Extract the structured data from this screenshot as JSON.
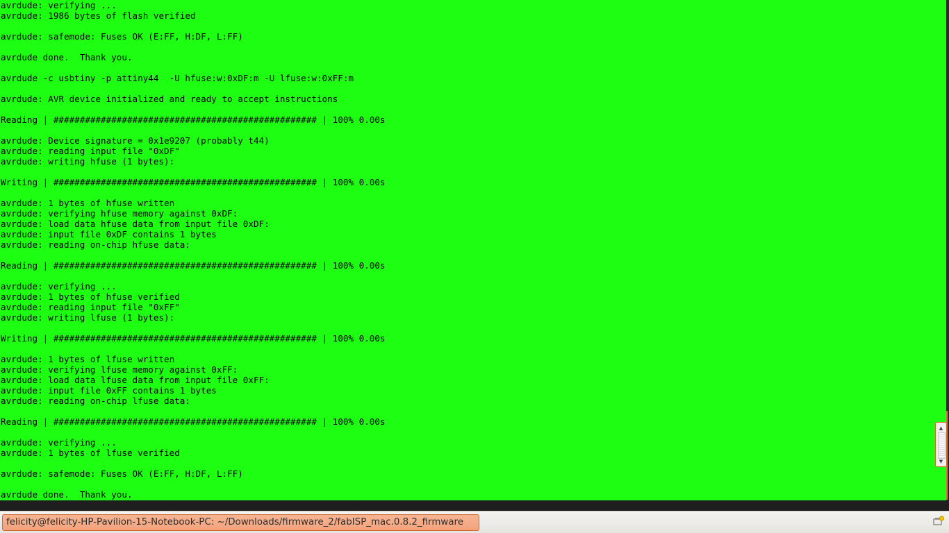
{
  "terminal": {
    "lines": [
      "avrdude: verifying ...",
      "avrdude: 1986 bytes of flash verified",
      "",
      "avrdude: safemode: Fuses OK (E:FF, H:DF, L:FF)",
      "",
      "avrdude done.  Thank you.",
      "",
      "avrdude -c usbtiny -p attiny44  -U hfuse:w:0xDF:m -U lfuse:w:0xFF:m",
      "",
      "avrdude: AVR device initialized and ready to accept instructions",
      "",
      "Reading | ################################################## | 100% 0.00s",
      "",
      "avrdude: Device signature = 0x1e9207 (probably t44)",
      "avrdude: reading input file \"0xDF\"",
      "avrdude: writing hfuse (1 bytes):",
      "",
      "Writing | ################################################## | 100% 0.00s",
      "",
      "avrdude: 1 bytes of hfuse written",
      "avrdude: verifying hfuse memory against 0xDF:",
      "avrdude: load data hfuse data from input file 0xDF:",
      "avrdude: input file 0xDF contains 1 bytes",
      "avrdude: reading on-chip hfuse data:",
      "",
      "Reading | ################################################## | 100% 0.00s",
      "",
      "avrdude: verifying ...",
      "avrdude: 1 bytes of hfuse verified",
      "avrdude: reading input file \"0xFF\"",
      "avrdude: writing lfuse (1 bytes):",
      "",
      "Writing | ################################################## | 100% 0.00s",
      "",
      "avrdude: 1 bytes of lfuse written",
      "avrdude: verifying lfuse memory against 0xFF:",
      "avrdude: load data lfuse data from input file 0xFF:",
      "avrdude: input file 0xFF contains 1 bytes",
      "avrdude: reading on-chip lfuse data:",
      "",
      "Reading | ################################################## | 100% 0.00s",
      "",
      "avrdude: verifying ...",
      "avrdude: 1 bytes of lfuse verified",
      "",
      "avrdude: safemode: Fuses OK (E:FF, H:DF, L:FF)",
      "",
      "avrdude done.  Thank you."
    ],
    "background_color": "#1efe13",
    "text_color": "#000000"
  },
  "scrollbar": {
    "up_icon": "arrow-up-icon",
    "down_icon": "arrow-down-icon",
    "up_glyph": "▲",
    "down_glyph": "▼"
  },
  "taskbar": {
    "window_title": "felicity@felicity-HP-Pavilion-15-Notebook-PC: ~/Downloads/firmware_2/fabISP_mac.0.8.2_firmware",
    "tray_icon": "notification-tray-icon",
    "active_color": "#f3a27c"
  }
}
